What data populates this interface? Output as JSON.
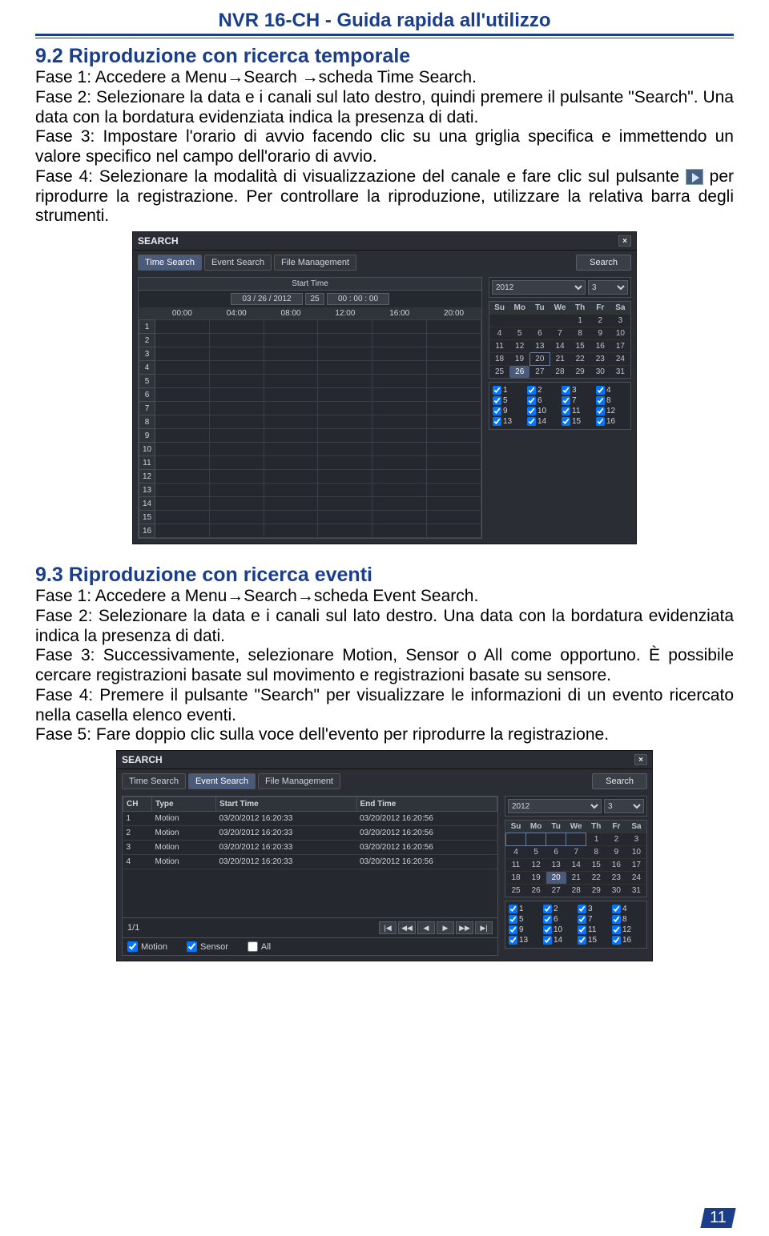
{
  "doc_title": "NVR 16-CH - Guida rapida all'utilizzo",
  "page_number": "11",
  "s92": {
    "heading": "9.2 Riproduzione con ricerca temporale",
    "p1": "Fase 1: Accedere a Menu→Search →scheda Time Search.",
    "p2": "Fase 2: Selezionare la data e i canali sul lato destro, quindi premere il pulsante \"Search\". Una data con la bordatura evidenziata indica la presenza di dati.",
    "p3": "Fase 3: Impostare l'orario di avvio facendo clic su una griglia specifica e immettendo un valore specifico nel campo dell'orario di avvio.",
    "p4a": "Fase 4: Selezionare la modalità di visualizzazione del canale e fare clic sul pulsante ",
    "p4b": " per riprodurre la registrazione. Per controllare la riproduzione, utilizzare la relativa barra degli strumenti."
  },
  "s93": {
    "heading": "9.3 Riproduzione con ricerca eventi",
    "p1": "Fase 1: Accedere a Menu→Search→scheda Event Search.",
    "p2": "Fase 2: Selezionare la data e i canali sul lato destro. Una data con la bordatura evidenziata indica la presenza di dati.",
    "p3": "Fase 3: Successivamente, selezionare Motion, Sensor o All come opportuno. È possibile cercare registrazioni basate sul movimento e registrazioni basate su sensore.",
    "p4": "Fase 4: Premere il pulsante \"Search\" per visualizzare le informazioni di un evento ricercato nella casella elenco eventi.",
    "p5": "Fase 5: Fare doppio clic sulla voce dell'evento per riprodurre la registrazione."
  },
  "nvr_common": {
    "title": "SEARCH",
    "tabs": {
      "time": "Time Search",
      "event": "Event Search",
      "file": "File Management"
    },
    "search_btn": "Search",
    "close": "×",
    "year": "2012",
    "month": "3",
    "weekdays": [
      "Su",
      "Mo",
      "Tu",
      "We",
      "Th",
      "Fr",
      "Sa"
    ],
    "channels": [
      "1",
      "2",
      "3",
      "4",
      "5",
      "6",
      "7",
      "8",
      "9",
      "10",
      "11",
      "12",
      "13",
      "14",
      "15",
      "16"
    ]
  },
  "time_panel": {
    "start_label": "Start Time",
    "date": "03 / 26 / 2012",
    "day": "25",
    "time": "00 : 00 : 00",
    "hours": [
      "00:00",
      "04:00",
      "08:00",
      "12:00",
      "16:00",
      "20:00"
    ],
    "rows": 16,
    "cal_days": [
      "",
      "",
      "",
      "",
      "1",
      "2",
      "3",
      "4",
      "5",
      "6",
      "7",
      "8",
      "9",
      "10",
      "11",
      "12",
      "13",
      "14",
      "15",
      "16",
      "17",
      "18",
      "19",
      "20",
      "21",
      "22",
      "23",
      "24",
      "25",
      "26",
      "27",
      "28",
      "29",
      "30",
      "31"
    ],
    "selected_day": "26",
    "hl_day": "20"
  },
  "event_panel": {
    "cols": {
      "ch": "CH",
      "type": "Type",
      "start": "Start Time",
      "end": "End Time"
    },
    "rows": [
      {
        "ch": "1",
        "type": "Motion",
        "start": "03/20/2012 16:20:33",
        "end": "03/20/2012 16:20:56"
      },
      {
        "ch": "2",
        "type": "Motion",
        "start": "03/20/2012 16:20:33",
        "end": "03/20/2012 16:20:56"
      },
      {
        "ch": "3",
        "type": "Motion",
        "start": "03/20/2012 16:20:33",
        "end": "03/20/2012 16:20:56"
      },
      {
        "ch": "4",
        "type": "Motion",
        "start": "03/20/2012 16:20:33",
        "end": "03/20/2012 16:20:56"
      }
    ],
    "page": "1/1",
    "cal_days": [
      "",
      "",
      "",
      "",
      "1",
      "2",
      "3",
      "4",
      "5",
      "6",
      "7",
      "8",
      "9",
      "10",
      "11",
      "12",
      "13",
      "14",
      "15",
      "16",
      "17",
      "18",
      "19",
      "20",
      "21",
      "22",
      "23",
      "24",
      "25",
      "26",
      "27",
      "28",
      "29",
      "30",
      "31"
    ],
    "selected_day": "20",
    "filters": {
      "motion": "Motion",
      "sensor": "Sensor",
      "all": "All"
    }
  }
}
